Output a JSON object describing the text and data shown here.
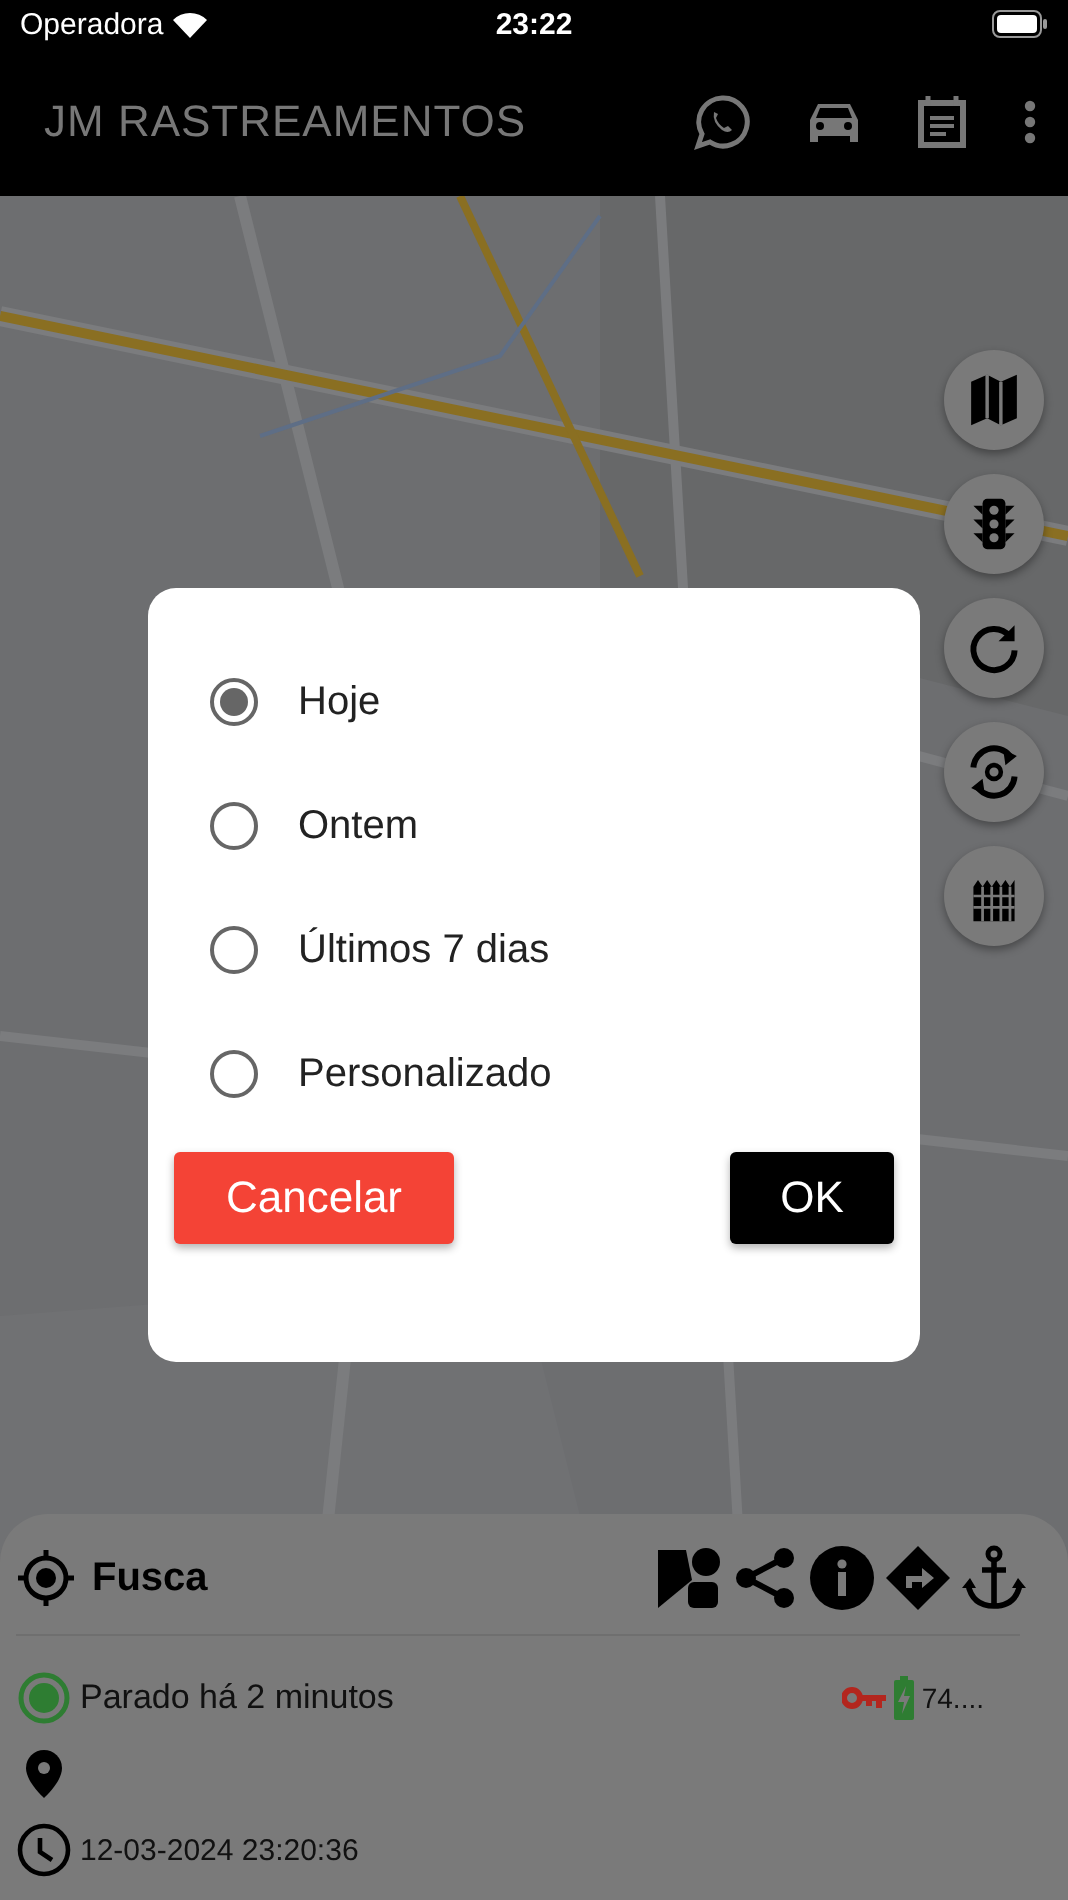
{
  "status_bar": {
    "carrier": "Operadora",
    "time": "23:22"
  },
  "app_bar": {
    "title": "JM RASTREAMENTOS"
  },
  "dialog": {
    "options": [
      {
        "label": "Hoje",
        "selected": true
      },
      {
        "label": "Ontem",
        "selected": false
      },
      {
        "label": "Últimos 7 dias",
        "selected": false
      },
      {
        "label": "Personalizado",
        "selected": false
      }
    ],
    "buttons": [
      {
        "label": "Cancelar",
        "kind": "cancel"
      },
      {
        "label": "OK",
        "kind": "confirm"
      }
    ]
  },
  "vehicle_panel": {
    "name": "Fusca",
    "status": "Parado há 2 minutos",
    "ignition_on": false,
    "battery": "74....",
    "timestamp": "12-03-2024 23:20:36"
  }
}
